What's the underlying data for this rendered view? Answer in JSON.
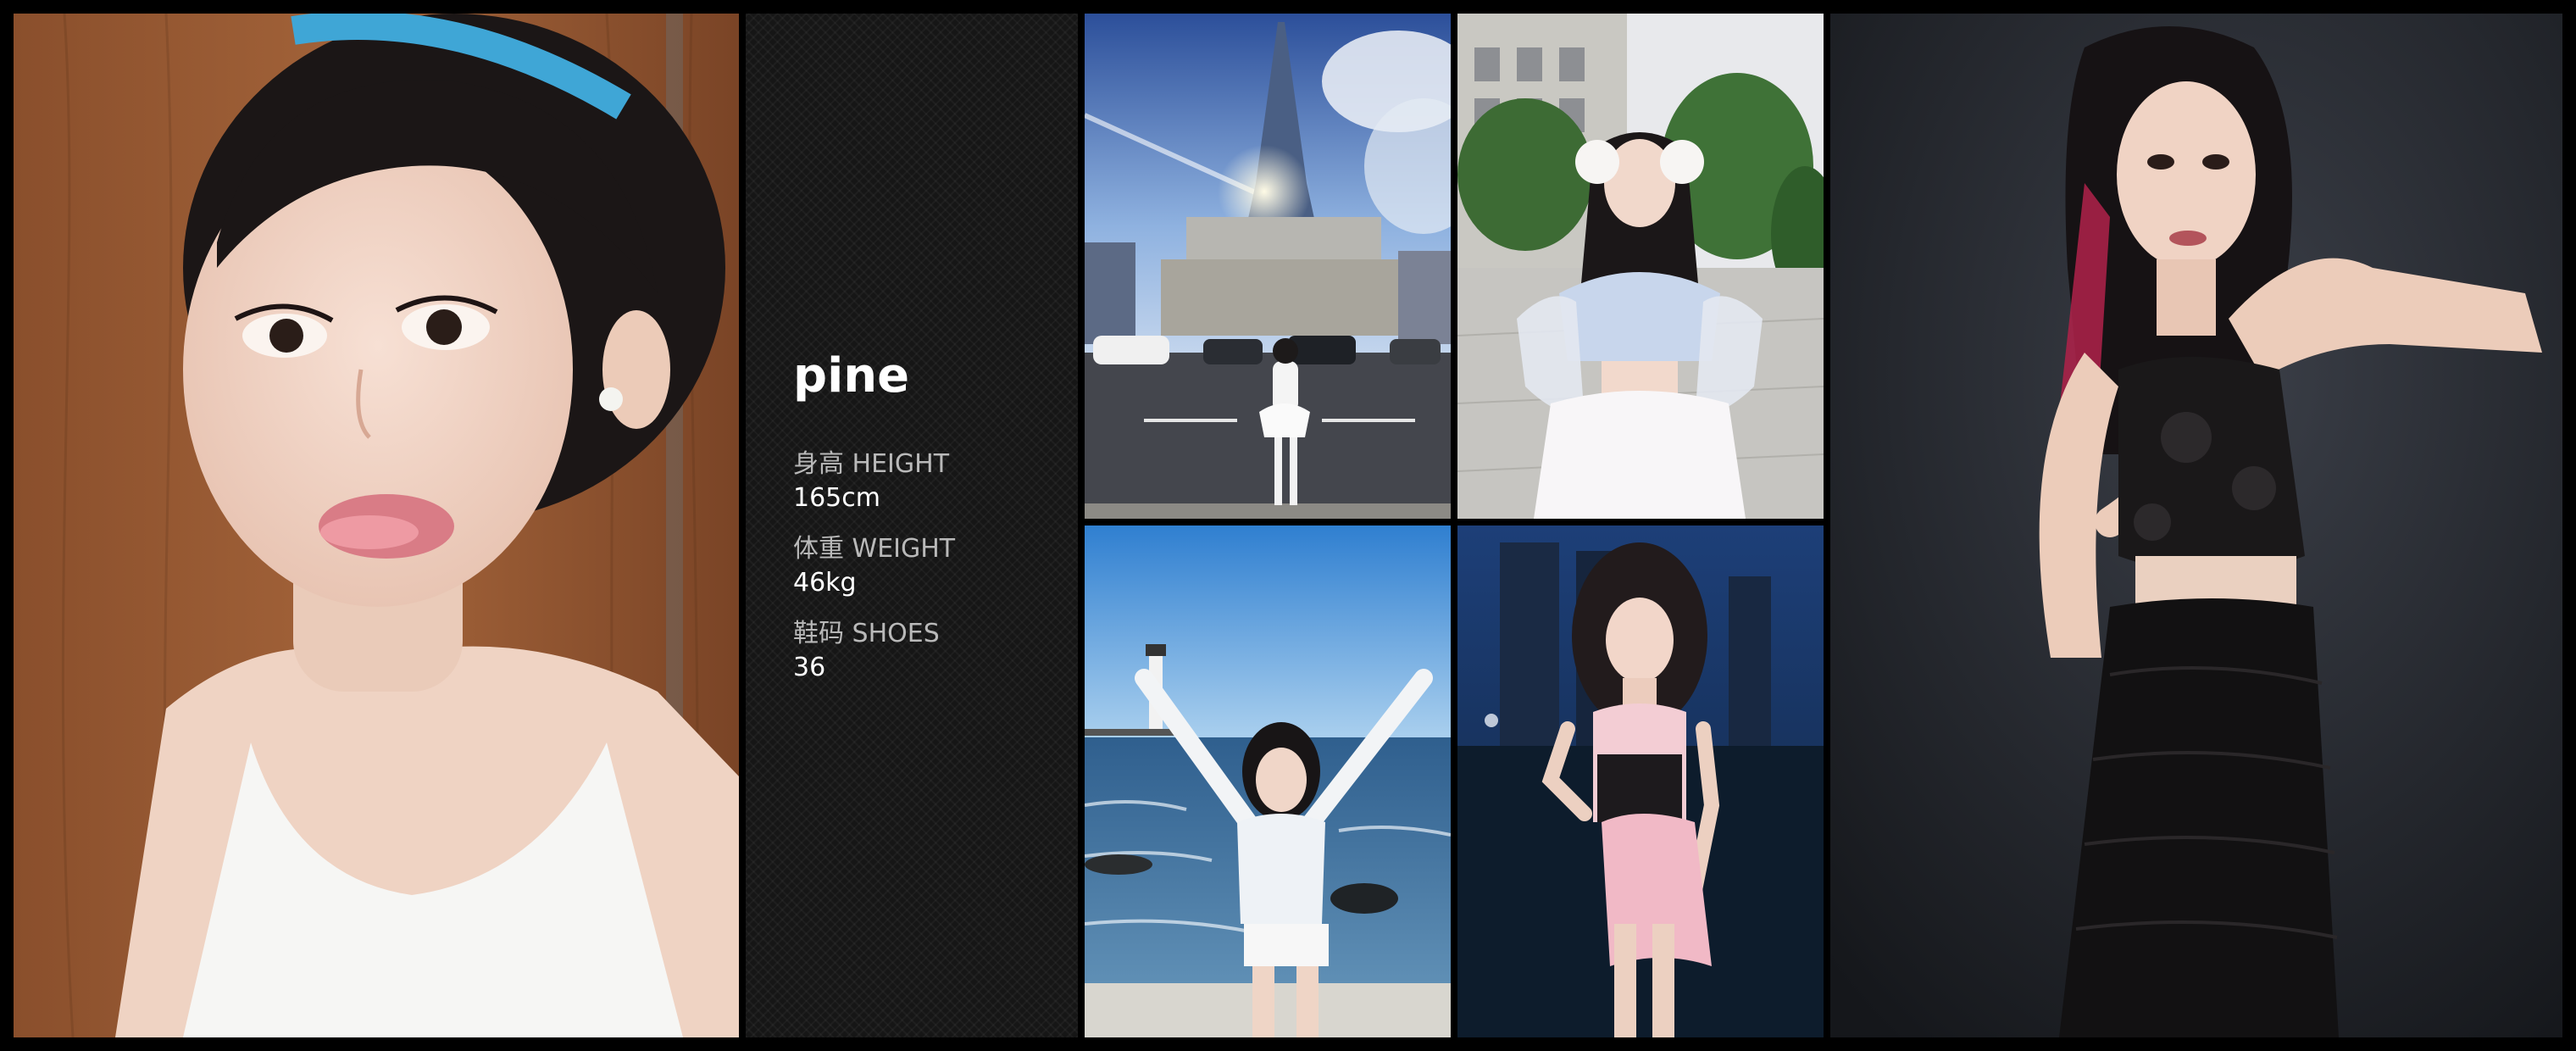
{
  "profile": {
    "name": "pine",
    "stats": [
      {
        "label": "身高 HEIGHT",
        "value": "165cm"
      },
      {
        "label": "体重 WEIGHT",
        "value": "46kg"
      },
      {
        "label": "鞋码 SHOES",
        "value": "36"
      }
    ]
  },
  "colors": {
    "background": "#000000",
    "panel": "#161616",
    "name_text": "#ffffff",
    "label_text": "#b9b9b9",
    "value_text": "#ffffff"
  }
}
